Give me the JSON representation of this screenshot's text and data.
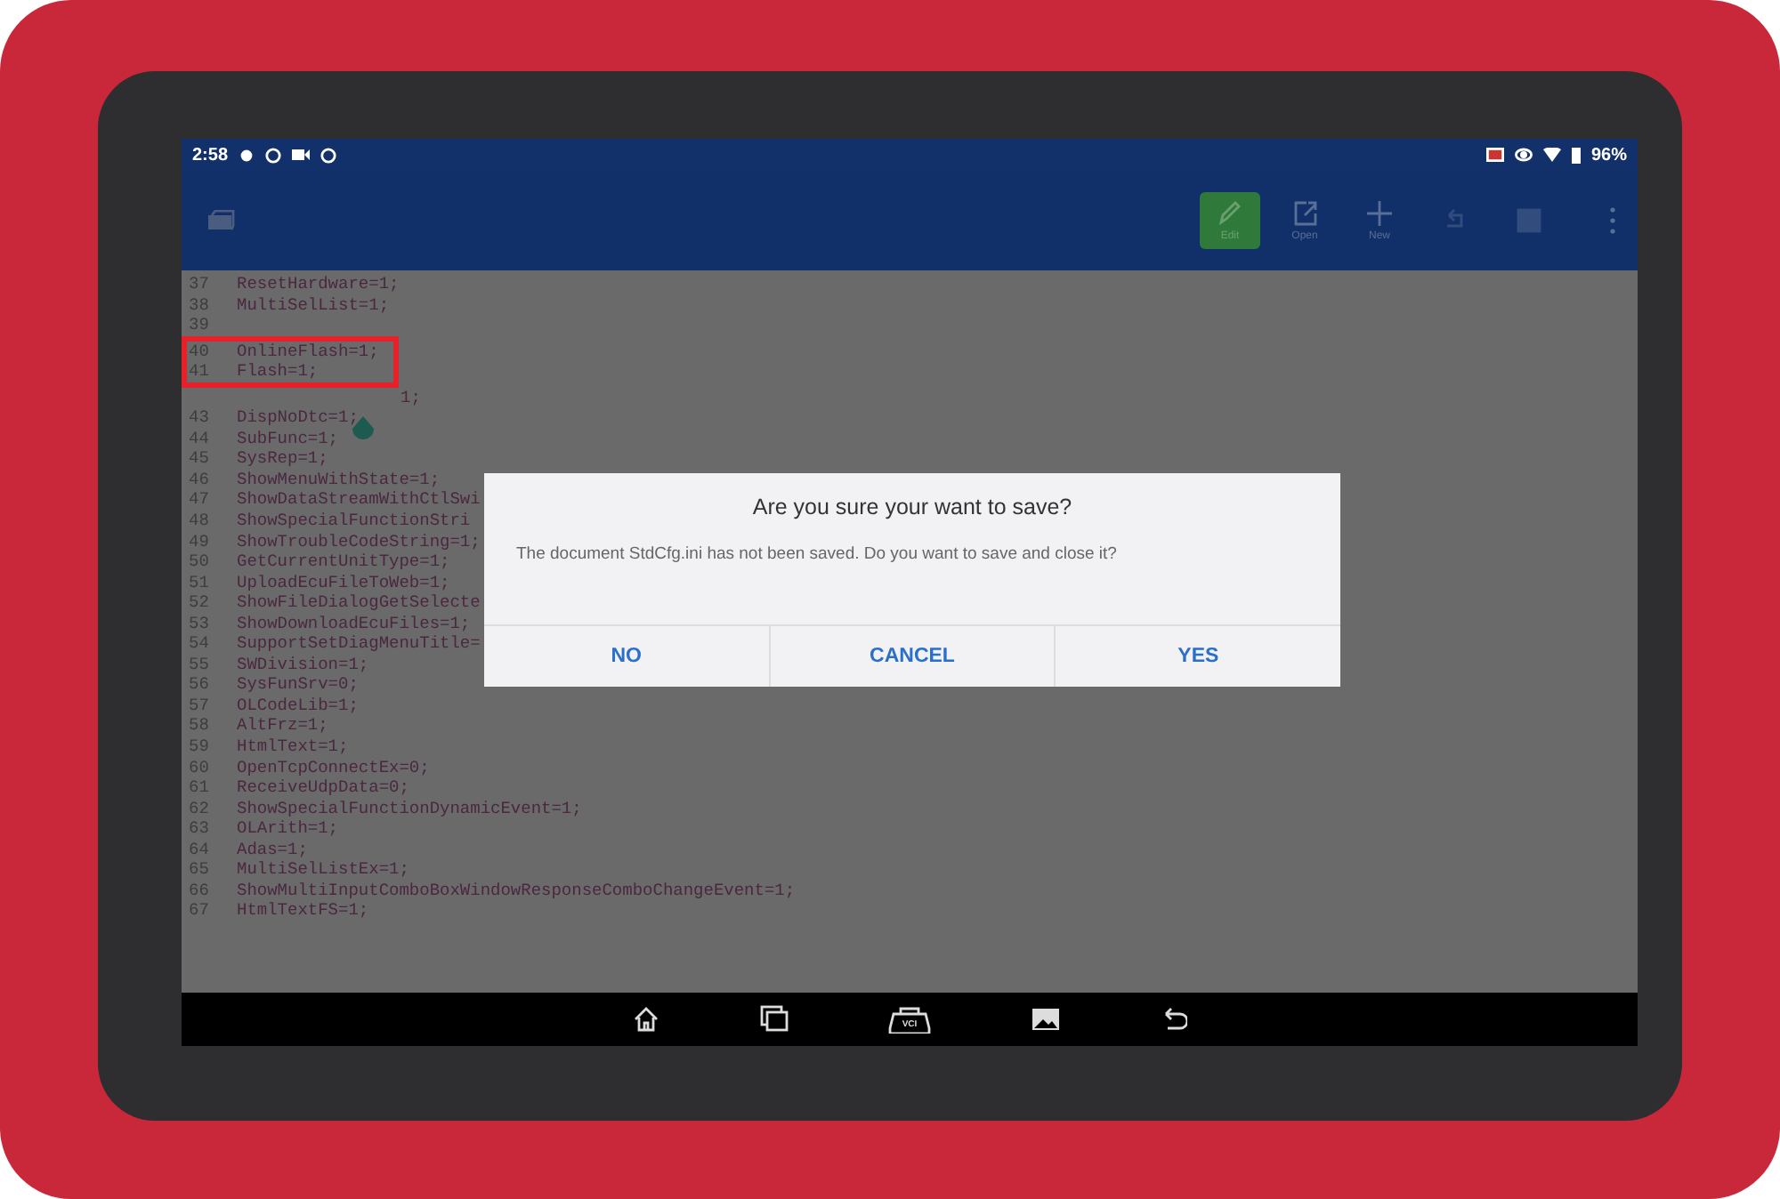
{
  "status_bar": {
    "time": "2:58",
    "battery": "96%"
  },
  "toolbar": {
    "actions": [
      {
        "kind": "edit",
        "label": "Edit",
        "selected": true,
        "disabled": false
      },
      {
        "kind": "open",
        "label": "Open",
        "selected": false,
        "disabled": false
      },
      {
        "kind": "new",
        "label": "New",
        "selected": false,
        "disabled": false
      },
      {
        "kind": "undo",
        "selected": false,
        "disabled": true
      },
      {
        "kind": "save",
        "selected": false,
        "disabled": true
      }
    ]
  },
  "editor": {
    "lines": [
      {
        "number": "37",
        "text": "ResetHardware=1;"
      },
      {
        "number": "38",
        "text": "MultiSelList=1;"
      },
      {
        "number": "39"
      },
      {
        "number": "40",
        "text": "OnlineFlash=1;",
        "highlighted": true
      },
      {
        "number": "41",
        "text": "Flash=1;",
        "highlighted": true
      },
      {
        "text": "1;"
      },
      {
        "number": "43",
        "text": "DispNoDtc=1;"
      },
      {
        "number": "44",
        "text": "SubFunc=1;"
      },
      {
        "number": "45",
        "text": "SysRep=1;"
      },
      {
        "number": "46",
        "text": "ShowMenuWithState=1;"
      },
      {
        "number": "47",
        "text": "ShowDataStreamWithCtlSwi"
      },
      {
        "number": "48",
        "text": "ShowSpecialFunctionStri"
      },
      {
        "number": "49",
        "text": "ShowTroubleCodeString=1;"
      },
      {
        "number": "50",
        "text": "GetCurrentUnitType=1;"
      },
      {
        "number": "51",
        "text": "UploadEcuFileToWeb=1;"
      },
      {
        "number": "52",
        "text": "ShowFileDialogGetSelecte"
      },
      {
        "number": "53",
        "text": "ShowDownloadEcuFiles=1;"
      },
      {
        "number": "54",
        "text": "SupportSetDiagMenuTitle="
      },
      {
        "number": "55",
        "text": "SWDivision=1;"
      },
      {
        "number": "56",
        "text": "SysFunSrv=0;"
      },
      {
        "number": "57",
        "text": "OLCodeLib=1;"
      },
      {
        "number": "58",
        "text": "AltFrz=1;"
      },
      {
        "number": "59",
        "text": "HtmlText=1;"
      },
      {
        "number": "60",
        "text": "OpenTcpConnectEx=0;"
      },
      {
        "number": "61",
        "text": "ReceiveUdpData=0;"
      },
      {
        "number": "62",
        "text": "ShowSpecialFunctionDynamicEvent=1;"
      },
      {
        "number": "63",
        "text": "OLArith=1;"
      },
      {
        "number": "64",
        "text": "Adas=1;"
      },
      {
        "number": "65",
        "text": "MultiSelListEx=1;"
      },
      {
        "number": "66",
        "text": "ShowMultiInputComboBoxWindowResponseComboChangeEvent=1;"
      },
      {
        "number": "67",
        "text": "HtmlTextFS=1;"
      }
    ]
  },
  "dialog": {
    "title": "Are you sure your want to save?",
    "message": "The document StdCfg.ini has not been saved. Do you want to save and close it?",
    "buttons": [
      "NO",
      "CANCEL",
      "YES"
    ]
  },
  "nav_bar": {
    "buttons": [
      {
        "kind": "home"
      },
      {
        "kind": "recents"
      },
      {
        "kind": "vci",
        "label": "VCI"
      },
      {
        "kind": "gallery"
      },
      {
        "kind": "back"
      }
    ]
  }
}
